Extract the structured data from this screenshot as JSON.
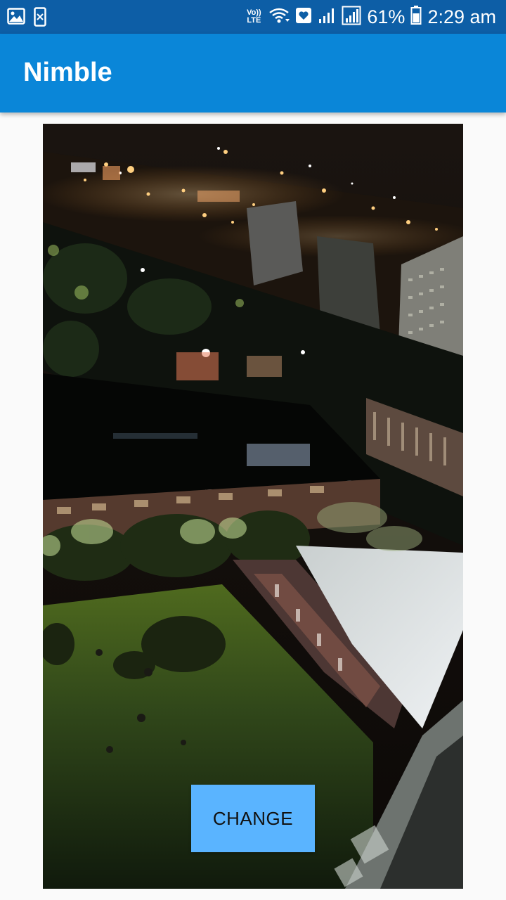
{
  "status_bar": {
    "left_icons": [
      "image-icon",
      "phone-download-icon"
    ],
    "network_label_top": "Vo))",
    "network_label_bottom": "LTE",
    "battery_percent": "61%",
    "time": "2:29 am"
  },
  "app_bar": {
    "title": "Nimble",
    "color": "#0a86d8"
  },
  "photo": {
    "subject": "photo"
  },
  "actions": {
    "change_label": "CHANGE",
    "button_color": "#5ab4ff"
  }
}
